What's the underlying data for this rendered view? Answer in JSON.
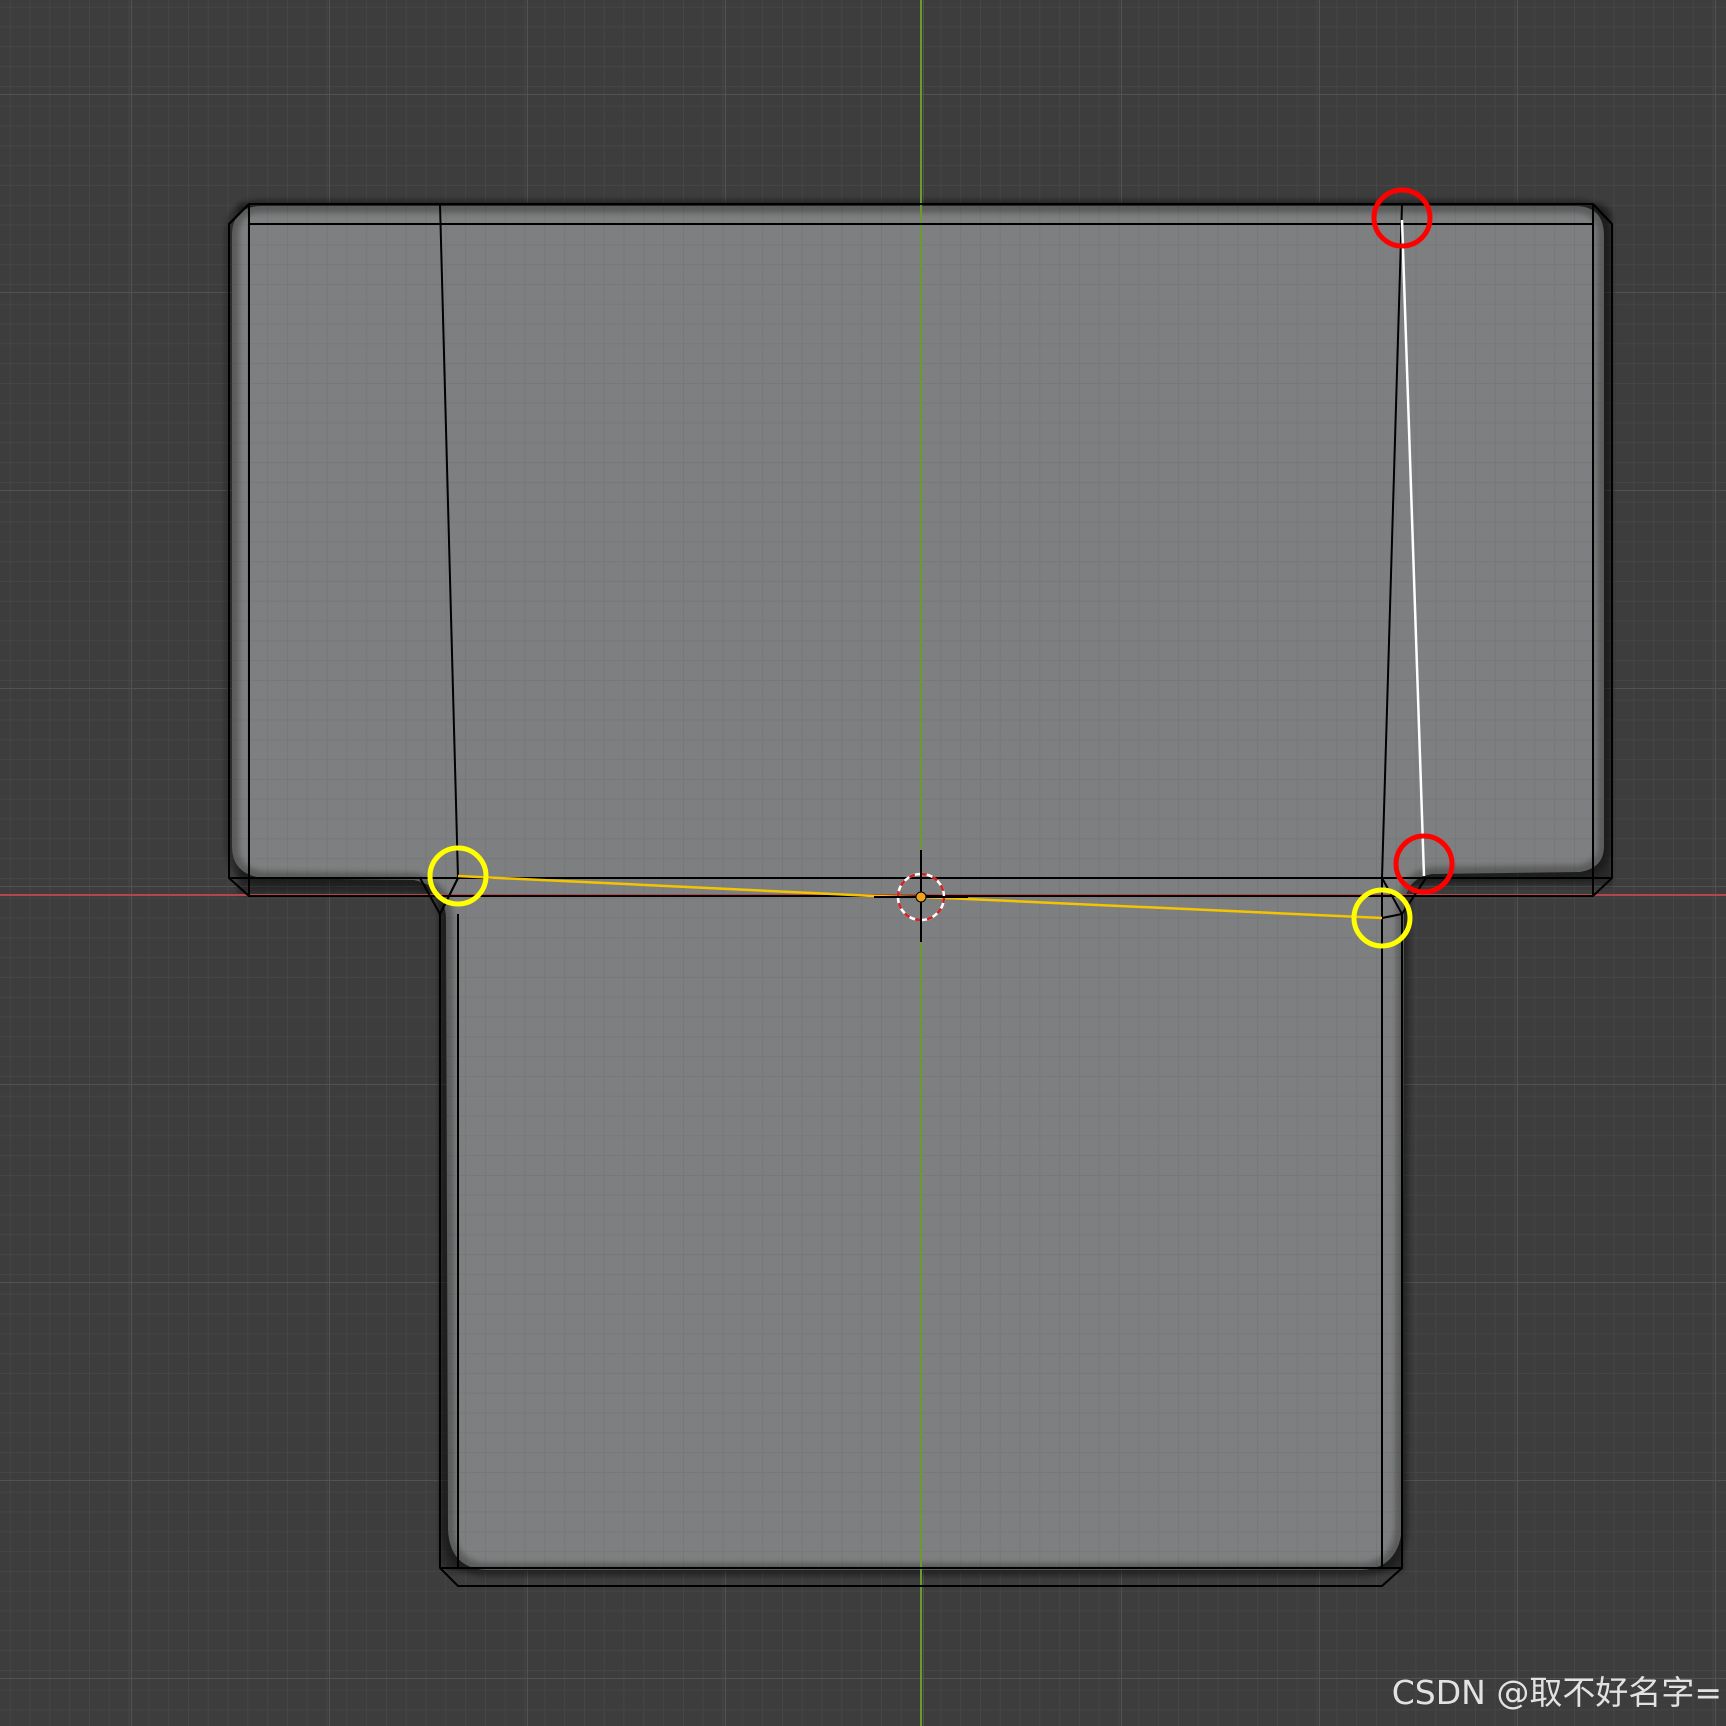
{
  "viewport": {
    "background_color": "#3d3d3d",
    "minor_grid_color": "#484848",
    "major_grid_color": "#525252",
    "x_axis_color": "#b5444c",
    "y_axis_color": "#6d9a2c",
    "mesh_fill_color": "#7e7f80",
    "mesh_edge_color": "#000000",
    "selected_edge_color": "#ffffff",
    "active_edge_color": "#f5c400"
  },
  "annotations": {
    "red_marker_color": "#ff0000",
    "yellow_marker_color": "#ffff00",
    "red_marker_count": 2,
    "yellow_marker_count": 2
  },
  "icons": {
    "origin": "object-origin-icon",
    "cursor": "3d-cursor-icon"
  },
  "watermark": {
    "text": "CSDN @取不好名字="
  }
}
